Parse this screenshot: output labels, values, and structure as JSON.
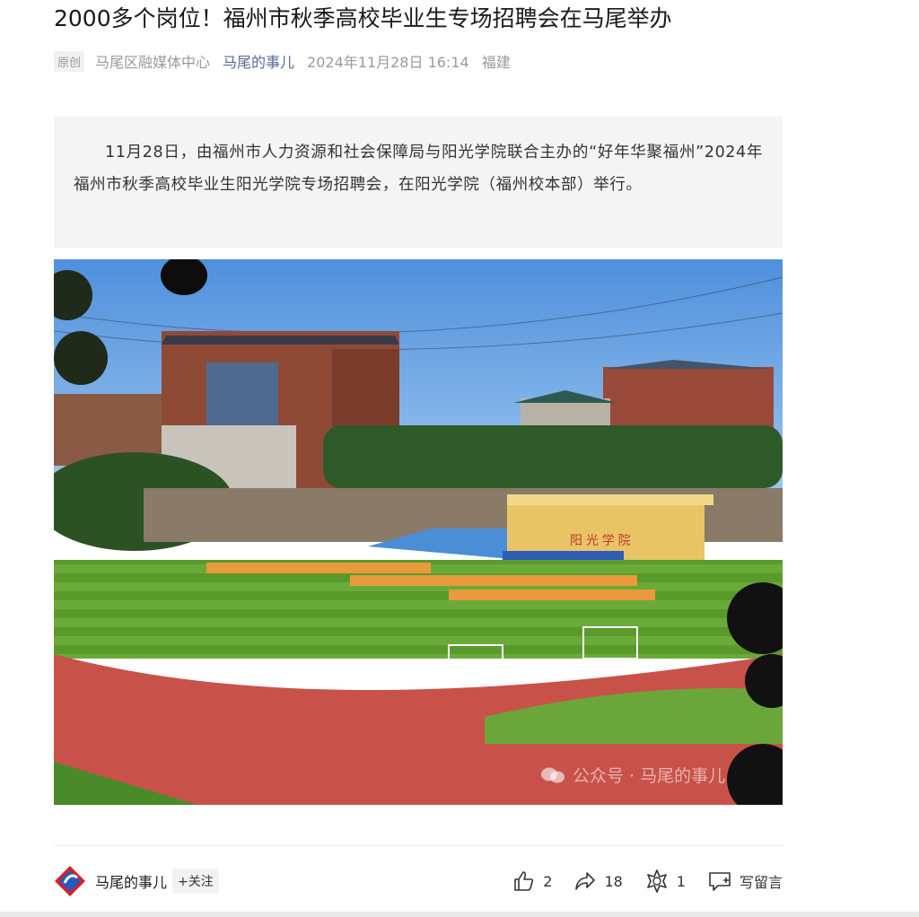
{
  "article": {
    "title": "2000多个岗位！福州市秋季高校毕业生专场招聘会在马尾举办",
    "meta": {
      "tag": "原创",
      "source": "马尾区融媒体中心",
      "account": "马尾的事儿",
      "datetime": "2024年11月28日 16:14",
      "location": "福建"
    },
    "summary": "11月28日，由福州市人力资源和社会保障局与阳光学院联合主办的“好年华聚福州”2024年福州市秋季高校毕业生阳光学院专场招聘会，在阳光学院（福州校本部）举行。",
    "photo": {
      "banner_text": "阳 光 学 院",
      "watermark": "公众号 · 马尾的事儿"
    }
  },
  "footer": {
    "account_name": "马尾的事儿",
    "follow_label": "+关注",
    "likes": "2",
    "shares": "18",
    "recommends": "1",
    "comment_label": "写留言"
  },
  "colors": {
    "accent": "#576b95",
    "summary_bg": "#f4f4f4",
    "sky": "#5e9be0",
    "track": "#c8524a",
    "grass": "#5f9e2e"
  },
  "icons": [
    "like-icon",
    "share-icon",
    "recommend-icon",
    "comment-icon",
    "wechat-icon",
    "logo-icon"
  ]
}
